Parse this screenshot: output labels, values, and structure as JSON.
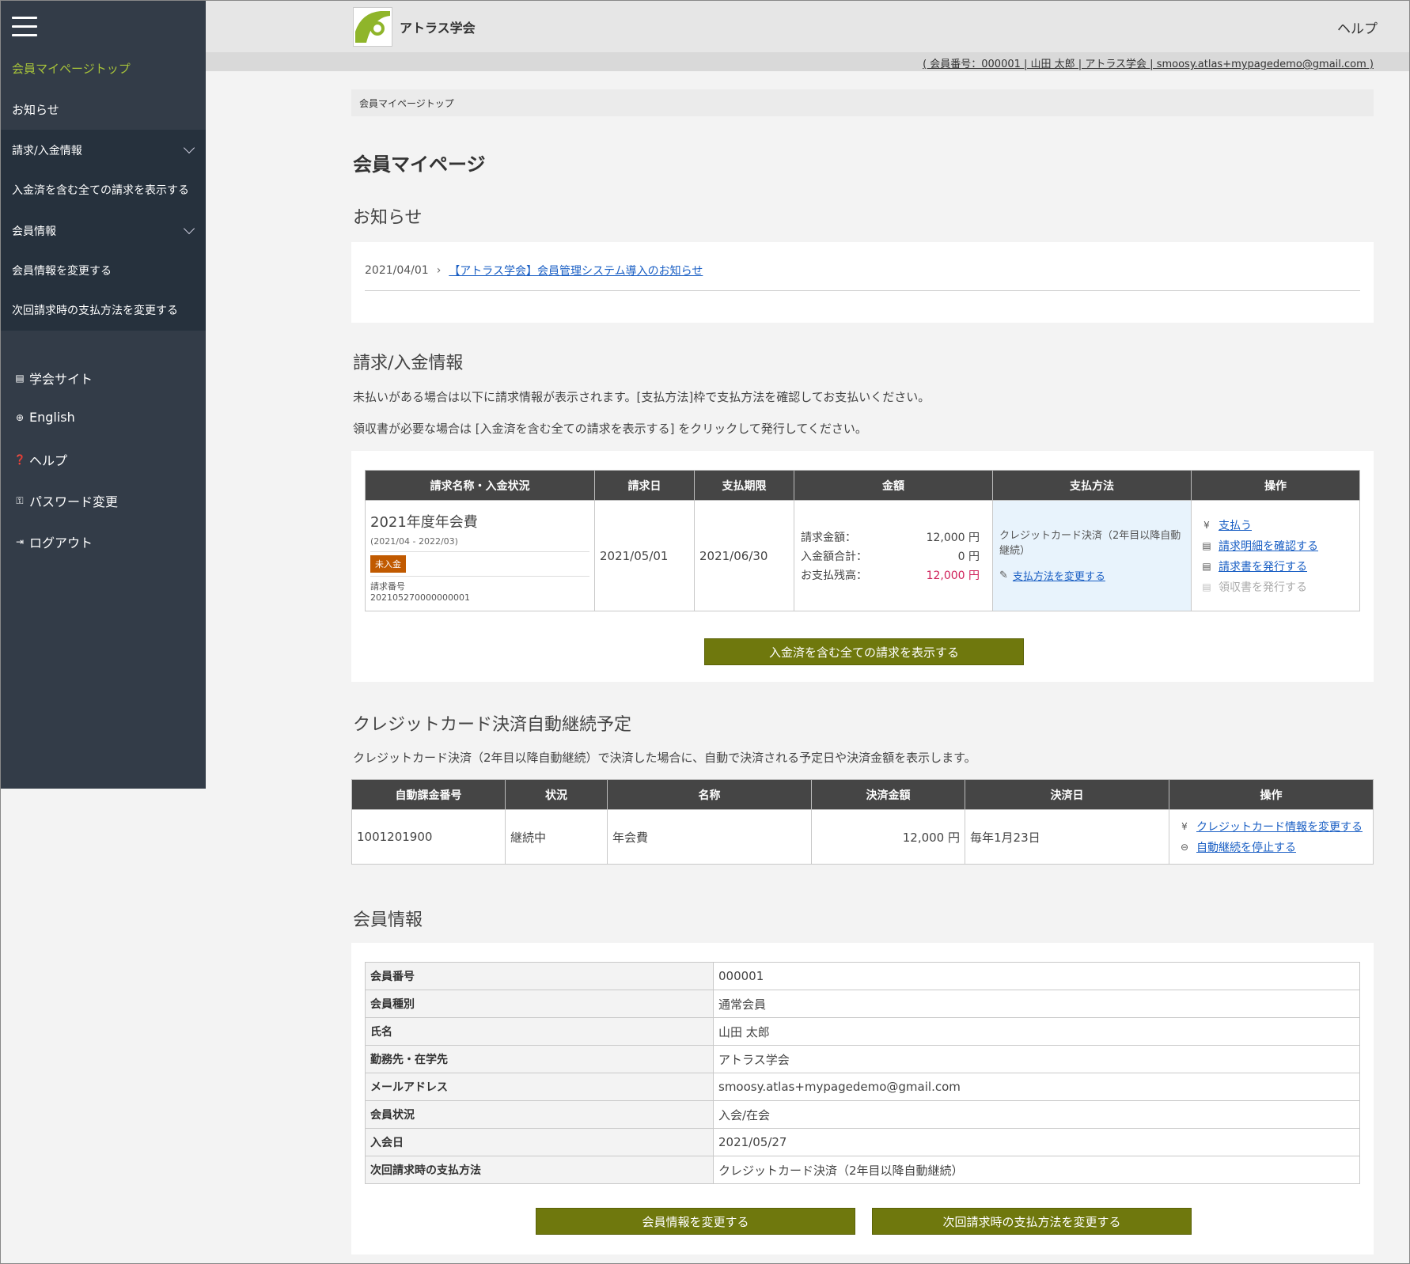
{
  "sidebar": {
    "items": [
      {
        "label": "会員マイページトップ"
      },
      {
        "label": "お知らせ"
      },
      {
        "label": "請求/入金情報"
      },
      {
        "label": "入金済を含む全ての請求を表示する"
      },
      {
        "label": "会員情報"
      },
      {
        "label": "会員情報を変更する"
      },
      {
        "label": "次回請求時の支払方法を変更する"
      }
    ],
    "links": [
      {
        "label": "学会サイト",
        "icon": "calendar-icon"
      },
      {
        "label": "English",
        "icon": "globe-icon"
      },
      {
        "label": "ヘルプ",
        "icon": "question-icon"
      },
      {
        "label": "パスワード変更",
        "icon": "key-icon"
      },
      {
        "label": "ログアウト",
        "icon": "logout-icon"
      }
    ]
  },
  "header": {
    "brand": "アトラス学会",
    "help": "ヘルプ",
    "user_info": "( 会員番号：000001 | 山田 太郎 | アトラス学会 | smoosy.atlas+mypagedemo@gmail.com )"
  },
  "breadcrumb": "会員マイページトップ",
  "page_title": "会員マイページ",
  "notices": {
    "title": "お知らせ",
    "items": [
      {
        "date": "2021/04/01",
        "text": "【アトラス学会】会員管理システム導入のお知らせ"
      }
    ]
  },
  "billing": {
    "title": "請求/入金情報",
    "desc1": "未払いがある場合は以下に請求情報が表示されます。[支払方法]枠で支払方法を確認してお支払いください。",
    "desc2": "領収書が必要な場合は [入金済を含む全ての請求を表示する] をクリックして発行してください。",
    "headers": [
      "請求名称・入金状況",
      "請求日",
      "支払期限",
      "金額",
      "支払方法",
      "操作"
    ],
    "row": {
      "name": "2021年度年会費",
      "period": "(2021/04 - 2022/03)",
      "status": "未入金",
      "invoice_label": "請求番号",
      "invoice_no": "202105270000000001",
      "bill_date": "2021/05/01",
      "due_date": "2021/06/30",
      "amount_label": "請求金額：",
      "amount": "12,000 円",
      "paid_label": "入金額合計：",
      "paid": "0 円",
      "balance_label": "お支払残高：",
      "balance": "12,000 円",
      "method": "クレジットカード決済（2年目以降自動継続）",
      "change_method": "支払方法を変更する",
      "ops": [
        "支払う",
        "請求明細を確認する",
        "請求書を発行する",
        "領収書を発行する"
      ]
    },
    "show_all_button": "入金済を含む全ての請求を表示する"
  },
  "auto_renew": {
    "title": "クレジットカード決済自動継続予定",
    "desc": "クレジットカード決済（2年目以降自動継続）で決済した場合に、自動で決済される予定日や決済金額を表示します。",
    "headers": [
      "自動課金番号",
      "状況",
      "名称",
      "決済金額",
      "決済日",
      "操作"
    ],
    "row": {
      "number": "1001201900",
      "status": "継続中",
      "name": "年会費",
      "amount": "12,000 円",
      "date": "毎年1月23日",
      "ops": [
        "クレジットカード情報を変更する",
        "自動継続を停止する"
      ]
    }
  },
  "member": {
    "title": "会員情報",
    "rows": [
      {
        "key": "会員番号",
        "value": "000001"
      },
      {
        "key": "会員種別",
        "value": "通常会員"
      },
      {
        "key": "氏名",
        "value": "山田 太郎"
      },
      {
        "key": "勤務先・在学先",
        "value": "アトラス学会"
      },
      {
        "key": "メールアドレス",
        "value": "smoosy.atlas+mypagedemo@gmail.com"
      },
      {
        "key": "会員状況",
        "value": "入会/在会"
      },
      {
        "key": "入会日",
        "value": "2021/05/27"
      },
      {
        "key": "次回請求時の支払方法",
        "value": "クレジットカード決済（2年目以降自動継続）"
      }
    ],
    "edit_button": "会員情報を変更する",
    "change_method_button": "次回請求時の支払方法を変更する"
  },
  "colors": {
    "sidebar_bg": "#333c48",
    "accent": "#a6c23a",
    "button": "#6f780d",
    "badge": "#c15a00",
    "balance": "#d0215a",
    "link": "#1a5fc4"
  }
}
